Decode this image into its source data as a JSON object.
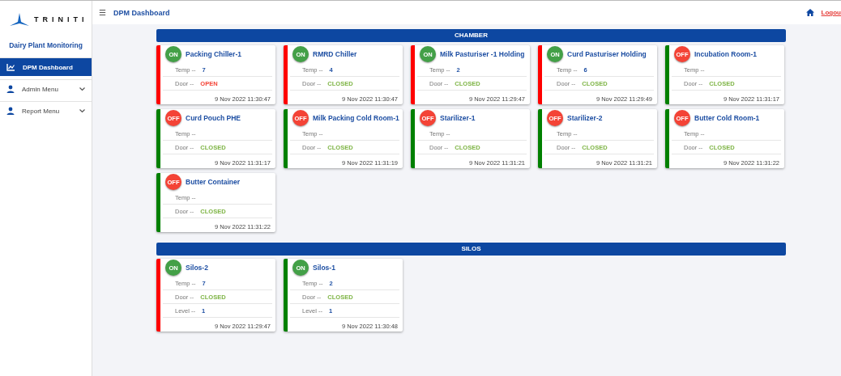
{
  "sidebar": {
    "brand": "TRINITI",
    "app_title": "Dairy Plant Monitoring",
    "items": [
      {
        "label": "DPM Dashboard",
        "selected": true,
        "expandable": false
      },
      {
        "label": "Admin Menu",
        "selected": false,
        "expandable": true
      },
      {
        "label": "Report Menu",
        "selected": false,
        "expandable": true
      }
    ]
  },
  "header": {
    "menu_icon": "☰",
    "title": "DPM Dashboard",
    "logout": "Logou"
  },
  "sections": [
    {
      "title": "CHAMBER",
      "cards": [
        {
          "name": "Packing Chiller-1",
          "status": "ON",
          "running": true,
          "color": "#ff0000",
          "rows": [
            {
              "label": "Temp --",
              "value": "7",
              "kind": "reading"
            },
            {
              "label": "Door --",
              "value": "OPEN",
              "kind": "open"
            }
          ],
          "time": "9 Nov 2022 11:30:47"
        },
        {
          "name": "RMRD Chiller",
          "status": "ON",
          "running": true,
          "color": "#ff0000",
          "rows": [
            {
              "label": "Temp --",
              "value": "4",
              "kind": "reading"
            },
            {
              "label": "Door --",
              "value": "CLOSED",
              "kind": "closed"
            }
          ],
          "time": "9 Nov 2022 11:30:47"
        },
        {
          "name": "Milk Pasturiser -1 Holding",
          "status": "ON",
          "running": true,
          "color": "#ff0000",
          "rows": [
            {
              "label": "Temp --",
              "value": "2",
              "kind": "reading"
            },
            {
              "label": "Door --",
              "value": "CLOSED",
              "kind": "closed"
            }
          ],
          "time": "9 Nov 2022 11:29:47"
        },
        {
          "name": "Curd Pasturiser Holding",
          "status": "ON",
          "running": true,
          "color": "#ff0000",
          "rows": [
            {
              "label": "Temp --",
              "value": "6",
              "kind": "reading"
            },
            {
              "label": "Door --",
              "value": "CLOSED",
              "kind": "closed"
            }
          ],
          "time": "9 Nov 2022 11:29:49"
        },
        {
          "name": "Incubation Room-1",
          "status": "OFF",
          "running": false,
          "color": "#008000",
          "rows": [
            {
              "label": "Temp --"
            },
            {
              "label": "Door --",
              "value": "CLOSED",
              "kind": "closed"
            }
          ],
          "time": "9 Nov 2022 11:31:17"
        },
        {
          "name": "Curd Pouch PHE",
          "status": "OFF",
          "running": false,
          "color": "#008000",
          "rows": [
            {
              "label": "Temp --"
            },
            {
              "label": "Door --",
              "value": "CLOSED",
              "kind": "closed"
            }
          ],
          "time": "9 Nov 2022 11:31:17"
        },
        {
          "name": "Milk Packing Cold Room-1",
          "status": "OFF",
          "running": false,
          "color": "#008000",
          "rows": [
            {
              "label": "Temp --"
            },
            {
              "label": "Door --",
              "value": "CLOSED",
              "kind": "closed"
            }
          ],
          "time": "9 Nov 2022 11:31:19"
        },
        {
          "name": "Starilizer-1",
          "status": "OFF",
          "running": false,
          "color": "#008000",
          "rows": [
            {
              "label": "Temp --"
            },
            {
              "label": "Door --",
              "value": "CLOSED",
              "kind": "closed"
            }
          ],
          "time": "9 Nov 2022 11:31:21"
        },
        {
          "name": "Starilizer-2",
          "status": "OFF",
          "running": false,
          "color": "#008000",
          "rows": [
            {
              "label": "Temp --"
            },
            {
              "label": "Door --",
              "value": "CLOSED",
              "kind": "closed"
            }
          ],
          "time": "9 Nov 2022 11:31:21"
        },
        {
          "name": "Butter Cold Room-1",
          "status": "OFF",
          "running": false,
          "color": "#008000",
          "rows": [
            {
              "label": "Temp --"
            },
            {
              "label": "Door --",
              "value": "CLOSED",
              "kind": "closed"
            }
          ],
          "time": "9 Nov 2022 11:31:22"
        },
        {
          "name": "Butter Container",
          "status": "OFF",
          "running": false,
          "color": "#008000",
          "rows": [
            {
              "label": "Temp --"
            },
            {
              "label": "Door --",
              "value": "CLOSED",
              "kind": "closed"
            }
          ],
          "time": "9 Nov 2022 11:31:22"
        }
      ]
    },
    {
      "title": "SILOS",
      "cards": [
        {
          "name": "Silos-2",
          "status": "ON",
          "running": true,
          "color": "#ff0000",
          "rows": [
            {
              "label": "Temp --",
              "value": "7",
              "kind": "reading"
            },
            {
              "label": "Door --",
              "value": "CLOSED",
              "kind": "closed"
            },
            {
              "label": "Level --",
              "value": "1",
              "kind": "reading"
            }
          ],
          "time": "9 Nov 2022 11:29:47"
        },
        {
          "name": "Silos-1",
          "status": "ON",
          "running": true,
          "color": "#008000",
          "rows": [
            {
              "label": "Temp --",
              "value": "2",
              "kind": "reading"
            },
            {
              "label": "Door --",
              "value": "CLOSED",
              "kind": "closed"
            },
            {
              "label": "Level --",
              "value": "1",
              "kind": "reading"
            }
          ],
          "time": "9 Nov 2022 11:30:48"
        }
      ]
    }
  ]
}
